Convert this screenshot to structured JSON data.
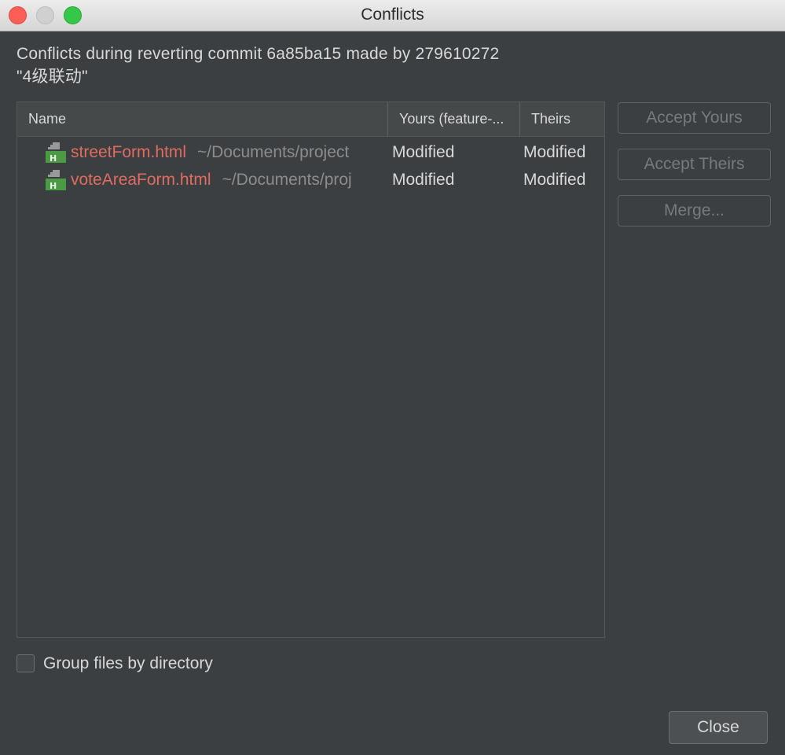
{
  "window": {
    "title": "Conflicts"
  },
  "message": {
    "line1": "Conflicts during reverting commit 6a85ba15 made by 279610272",
    "line2": "\"4级联动\""
  },
  "table": {
    "columns": {
      "name": "Name",
      "yours": "Yours (feature-...",
      "theirs": "Theirs"
    },
    "rows": [
      {
        "icon": "html-file-icon",
        "file_name": "streetForm.html",
        "path": "~/Documents/project",
        "yours": "Modified",
        "theirs": "Modified"
      },
      {
        "icon": "html-file-icon",
        "file_name": "voteAreaForm.html",
        "path": "~/Documents/proj",
        "yours": "Modified",
        "theirs": "Modified"
      }
    ]
  },
  "buttons": {
    "accept_yours": "Accept Yours",
    "accept_theirs": "Accept Theirs",
    "merge": "Merge...",
    "close": "Close"
  },
  "options": {
    "group_by_directory_label": "Group files by directory",
    "group_by_directory_checked": false
  },
  "colors": {
    "background": "#3c3f41",
    "conflict_file_name": "#e06c60",
    "path_text": "#8c8c8c",
    "text": "#d8d8d8",
    "disabled_button_text": "#777a7c"
  }
}
